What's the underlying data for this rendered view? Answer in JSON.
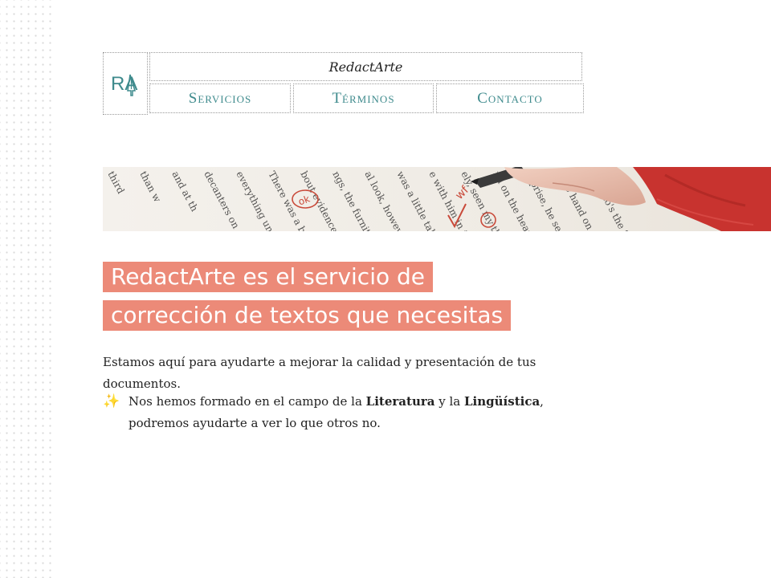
{
  "brand": {
    "logo_text": "RA",
    "site_title": "RedactArte"
  },
  "nav": {
    "items": [
      {
        "label": "Servicios"
      },
      {
        "label": "Términos"
      },
      {
        "label": "Contacto"
      }
    ]
  },
  "hero": {
    "proof_lines": [
      "third",
      "than w",
      "and at th",
      "decanters on",
      "everything und",
      "There was a book",
      "bout evidence, cri",
      "ngs, the furniture w",
      "al look, however, a",
      "was a little table of",
      "e with him in that",
      "ely, seen my thin",
      "nd on the hearth",
      "urprise, he se",
      "arge hand on",
      "ar. Who's the Spid"
    ],
    "proof_marks": [
      "ok",
      "wf"
    ]
  },
  "main": {
    "headline_line1": "RedactArte es el servicio de",
    "headline_line2": "corrección de textos que necesitas",
    "intro": "Estamos aquí para ayudarte a mejorar la calidad y presentación de tus documentos.",
    "bullet_icon": "sparkles-icon",
    "bullet_prefix": "Nos hemos formado en el campo de la ",
    "bullet_term1": "Literatura",
    "bullet_mid": " y la ",
    "bullet_term2": "Lingüística",
    "bullet_suffix": ", podremos ayudarte a ver lo que otros no."
  },
  "colors": {
    "accent_teal": "#3f8b8d",
    "highlight_salmon": "#ec8a78",
    "glove_red": "#c8332f"
  }
}
